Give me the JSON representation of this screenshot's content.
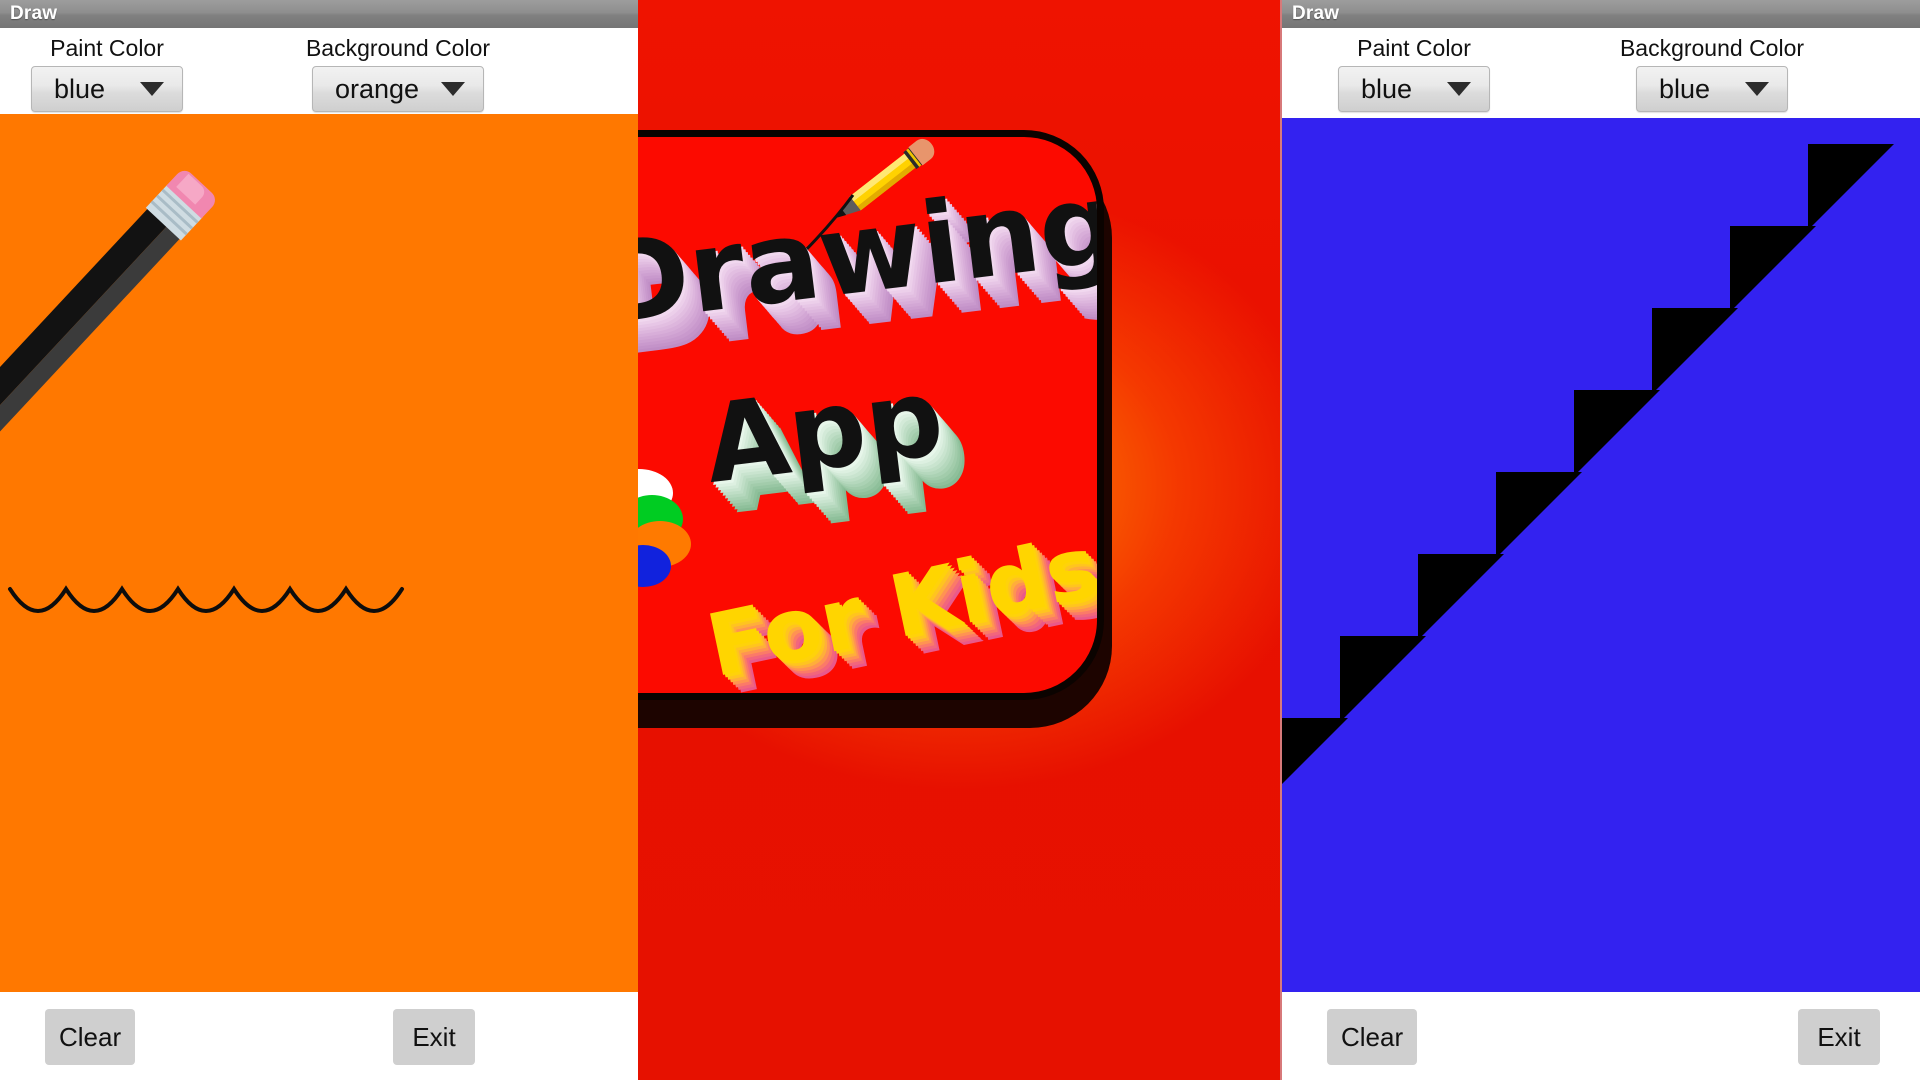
{
  "app": {
    "window_title": "Draw",
    "paint_color_label": "Paint Color",
    "background_color_label": "Background Color",
    "clear_label": "Clear",
    "exit_label": "Exit"
  },
  "left_panel": {
    "window_title": "Draw",
    "paint_color_label": "Paint Color",
    "paint_color_value": "blue",
    "background_color_label": "Background Color",
    "background_color_value": "orange",
    "canvas_background": "#FF7800",
    "stroke_color": "#000000",
    "drawing": "wavy-scallop-line",
    "clear_label": "Clear",
    "exit_label": "Exit"
  },
  "center_panel": {
    "app_icon_title_line1": "Drawing",
    "app_icon_title_line2": "App",
    "app_icon_subtitle": "For Kids",
    "card_color": "#FC0A00",
    "background_color": "#E81100",
    "glow_color": "#FF9600",
    "title_extrude_color": "#C493C9",
    "app_extrude_color": "#8FC09B",
    "subtitle_color": "#FFD500",
    "palette_colors": [
      "#FFFFFF",
      "#E8489B",
      "#8A15C8",
      "#00CC22",
      "#FF7A00",
      "#FFD700",
      "#1122DD"
    ],
    "pencil_color": "#FFD200"
  },
  "right_panel": {
    "window_title": "Draw",
    "paint_color_label": "Paint Color",
    "paint_color_value": "blue",
    "background_color_label": "Background Color",
    "background_color_value": "blue",
    "canvas_background": "#3322F0",
    "stroke_color": "#000000",
    "drawing": "zigzag-sawtooth-line",
    "clear_label": "Clear",
    "exit_label": "Exit"
  }
}
